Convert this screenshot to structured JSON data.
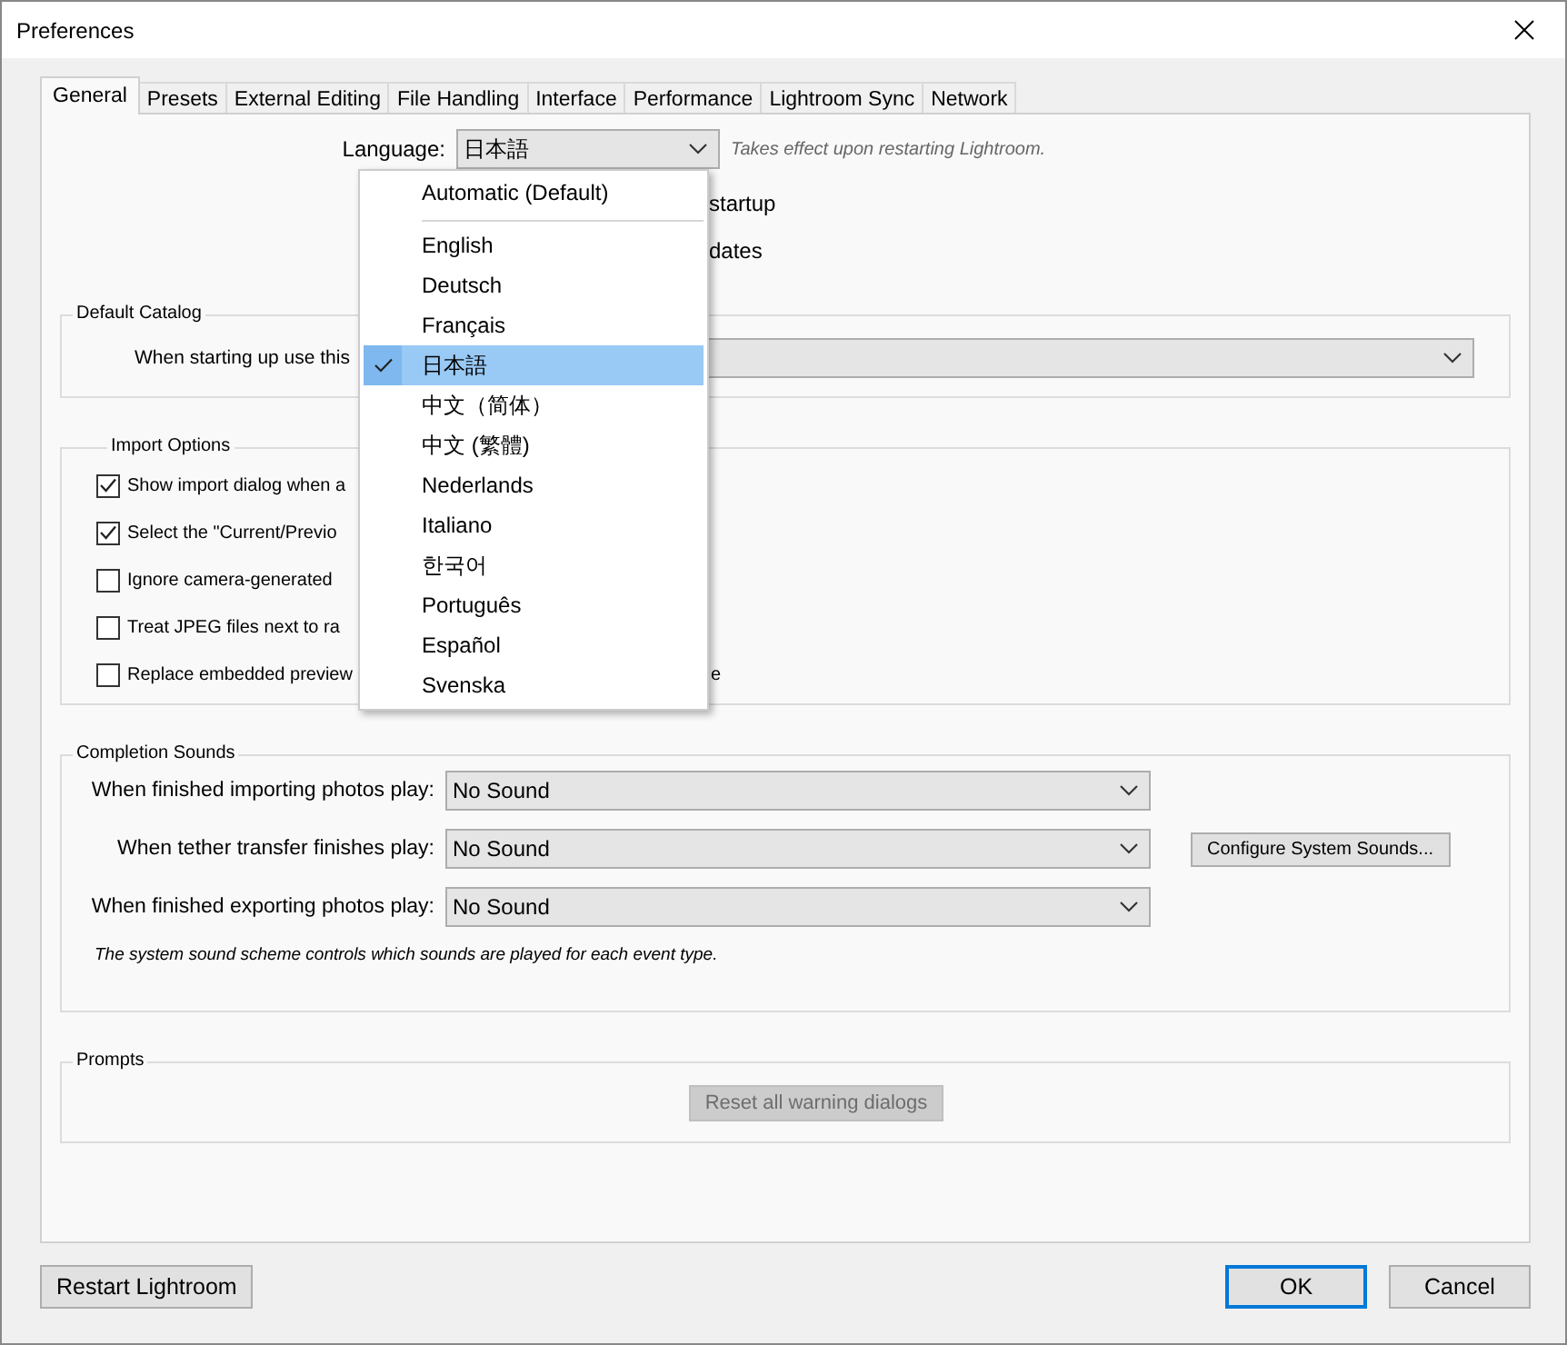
{
  "window": {
    "title": "Preferences"
  },
  "tabs": [
    {
      "label": "General",
      "selected": true
    },
    {
      "label": "Presets",
      "selected": false
    },
    {
      "label": "External Editing",
      "selected": false
    },
    {
      "label": "File Handling",
      "selected": false
    },
    {
      "label": "Interface",
      "selected": false
    },
    {
      "label": "Performance",
      "selected": false
    },
    {
      "label": "Lightroom Sync",
      "selected": false
    },
    {
      "label": "Network",
      "selected": false
    }
  ],
  "general": {
    "language_label": "Language:",
    "language_value": "日本語",
    "language_note": "Takes effect upon restarting Lightroom.",
    "partial_lines": [
      "startup",
      "dates"
    ]
  },
  "language_menu": {
    "items": [
      {
        "kind": "item",
        "label": "Automatic (Default)",
        "selected": false
      },
      {
        "kind": "separator"
      },
      {
        "kind": "item",
        "label": "English",
        "selected": false
      },
      {
        "kind": "item",
        "label": "Deutsch",
        "selected": false
      },
      {
        "kind": "item",
        "label": "Français",
        "selected": false
      },
      {
        "kind": "item",
        "label": "日本語",
        "selected": true
      },
      {
        "kind": "item",
        "label": "中文（简体）",
        "selected": false
      },
      {
        "kind": "item",
        "label": "中文 (繁體)",
        "selected": false
      },
      {
        "kind": "item",
        "label": "Nederlands",
        "selected": false
      },
      {
        "kind": "item",
        "label": "Italiano",
        "selected": false
      },
      {
        "kind": "item",
        "label": "한국어",
        "selected": false
      },
      {
        "kind": "item",
        "label": "Português",
        "selected": false
      },
      {
        "kind": "item",
        "label": "Español",
        "selected": false
      },
      {
        "kind": "item",
        "label": "Svenska",
        "selected": false
      }
    ]
  },
  "default_catalog": {
    "title": "Default Catalog",
    "label": "When starting up use this"
  },
  "import_options": {
    "title": "Import Options",
    "options": [
      {
        "label": "Show import dialog when a",
        "checked": true
      },
      {
        "label": "Select the \"Current/Previo",
        "checked": true
      },
      {
        "label": "Ignore camera-generated",
        "checked": false
      },
      {
        "label": "Treat JPEG files next to ra",
        "checked": false
      },
      {
        "label": "Replace embedded preview",
        "checked": false,
        "tail": "e"
      }
    ]
  },
  "completion_sounds": {
    "title": "Completion Sounds",
    "rows": [
      {
        "label": "When finished importing photos play:",
        "value": "No Sound"
      },
      {
        "label": "When tether transfer finishes play:",
        "value": "No Sound",
        "button": "Configure System Sounds..."
      },
      {
        "label": "When finished exporting photos play:",
        "value": "No Sound"
      }
    ],
    "note": "The system sound scheme controls which sounds are played for each event type."
  },
  "prompts": {
    "title": "Prompts",
    "reset_button": {
      "label": "Reset all warning dialogs",
      "disabled": true
    }
  },
  "footer": {
    "restart_button": "Restart Lightroom",
    "buttons": [
      {
        "label": "OK",
        "default": true
      },
      {
        "label": "Cancel",
        "default": false
      }
    ]
  }
}
